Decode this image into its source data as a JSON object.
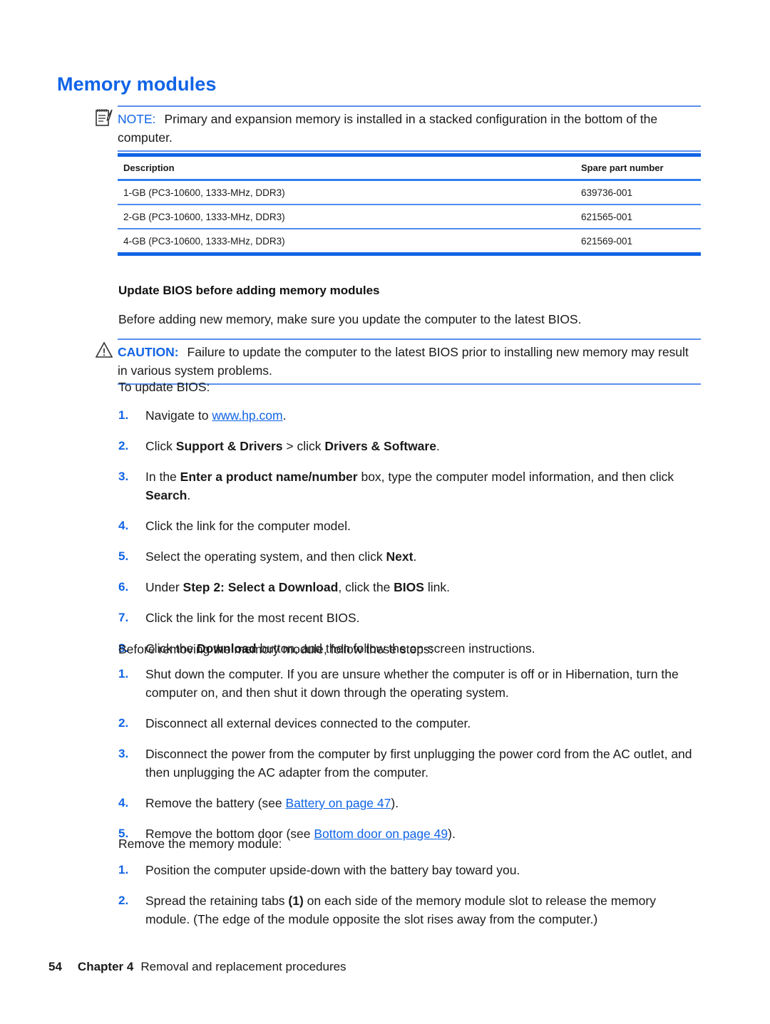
{
  "page": {
    "heading": "Memory modules",
    "footer": {
      "page_number": "54",
      "chapter_label": "Chapter 4",
      "chapter_title": "Removal and replacement procedures"
    },
    "colors": {
      "heading_blue": "#1064e6",
      "rule_blue": "#1064e6",
      "rule_light_blue": "#5c90ec",
      "link_blue": "#1064e6",
      "body_text": "#1a1a1a"
    }
  },
  "note": {
    "icon": "note-pad-pencil-icon",
    "label": "NOTE:",
    "text": "Primary and expansion memory is installed in a stacked configuration in the bottom of the computer."
  },
  "table": {
    "columns": [
      "Description",
      "Spare part number"
    ],
    "rows": [
      {
        "description": "1-GB (PC3-10600, 1333-MHz, DDR3)",
        "part": "639736-001"
      },
      {
        "description": "2-GB (PC3-10600, 1333-MHz, DDR3)",
        "part": "621565-001"
      },
      {
        "description": "4-GB (PC3-10600, 1333-MHz, DDR3)",
        "part": "621569-001"
      }
    ]
  },
  "section": {
    "subheading": "Update BIOS before adding memory modules",
    "intro": "Before adding new memory, make sure you update the computer to the latest BIOS."
  },
  "caution": {
    "icon": "warning-triangle-icon",
    "label": "CAUTION:",
    "text": "Failure to update the computer to the latest BIOS prior to installing new memory may result in various system problems."
  },
  "bios_list": {
    "lead_in": "To update BIOS:",
    "items": [
      {
        "num": "1.",
        "pre": "Navigate to ",
        "link": "www.hp.com",
        "post": "."
      },
      {
        "num": "2.",
        "segments": [
          {
            "t": "Click ",
            "b": false
          },
          {
            "t": "Support & Drivers",
            "b": true
          },
          {
            "t": " > click ",
            "b": false
          },
          {
            "t": "Drivers & Software",
            "b": true
          },
          {
            "t": ".",
            "b": false
          }
        ]
      },
      {
        "num": "3.",
        "segments": [
          {
            "t": "In the ",
            "b": false
          },
          {
            "t": "Enter a product name/number",
            "b": true
          },
          {
            "t": " box, type the computer model information, and then click ",
            "b": false
          },
          {
            "t": "Search",
            "b": true
          },
          {
            "t": ".",
            "b": false
          }
        ]
      },
      {
        "num": "4.",
        "segments": [
          {
            "t": "Click the link for the computer model.",
            "b": false
          }
        ]
      },
      {
        "num": "5.",
        "segments": [
          {
            "t": "Select the operating system, and then click ",
            "b": false
          },
          {
            "t": "Next",
            "b": true
          },
          {
            "t": ".",
            "b": false
          }
        ]
      },
      {
        "num": "6.",
        "segments": [
          {
            "t": "Under ",
            "b": false
          },
          {
            "t": "Step 2: Select a Download",
            "b": true
          },
          {
            "t": ", click the ",
            "b": false
          },
          {
            "t": "BIOS",
            "b": true
          },
          {
            "t": " link.",
            "b": false
          }
        ]
      },
      {
        "num": "7.",
        "segments": [
          {
            "t": "Click the link for the most recent BIOS.",
            "b": false
          }
        ]
      },
      {
        "num": "8.",
        "segments": [
          {
            "t": "Click the ",
            "b": false
          },
          {
            "t": "Download",
            "b": true
          },
          {
            "t": " button, and then follow the on-screen instructions.",
            "b": false
          }
        ]
      }
    ]
  },
  "before_removing": {
    "lead_in": "Before removing the memory module, follow these steps:",
    "items": [
      {
        "num": "1.",
        "text": "Shut down the computer. If you are unsure whether the computer is off or in Hibernation, turn the computer on, and then shut it down through the operating system."
      },
      {
        "num": "2.",
        "text": "Disconnect all external devices connected to the computer."
      },
      {
        "num": "3.",
        "text": "Disconnect the power from the computer by first unplugging the power cord from the AC outlet, and then unplugging the AC adapter from the computer."
      },
      {
        "num": "4.",
        "pre": "Remove the battery (see ",
        "link": "Battery on page 47",
        "post": ")."
      },
      {
        "num": "5.",
        "pre": "Remove the bottom door (see ",
        "link": "Bottom door on page 49",
        "post": ")."
      }
    ]
  },
  "remove_module": {
    "lead_in": "Remove the memory module:",
    "items": [
      {
        "num": "1.",
        "segments": [
          {
            "t": "Position the computer upside-down with the battery bay toward you.",
            "b": false
          }
        ]
      },
      {
        "num": "2.",
        "segments": [
          {
            "t": "Spread the retaining tabs ",
            "b": false
          },
          {
            "t": "(1)",
            "b": true
          },
          {
            "t": " on each side of the memory module slot to release the memory module. (The edge of the module opposite the slot rises away from the computer.)",
            "b": false
          }
        ]
      }
    ]
  }
}
